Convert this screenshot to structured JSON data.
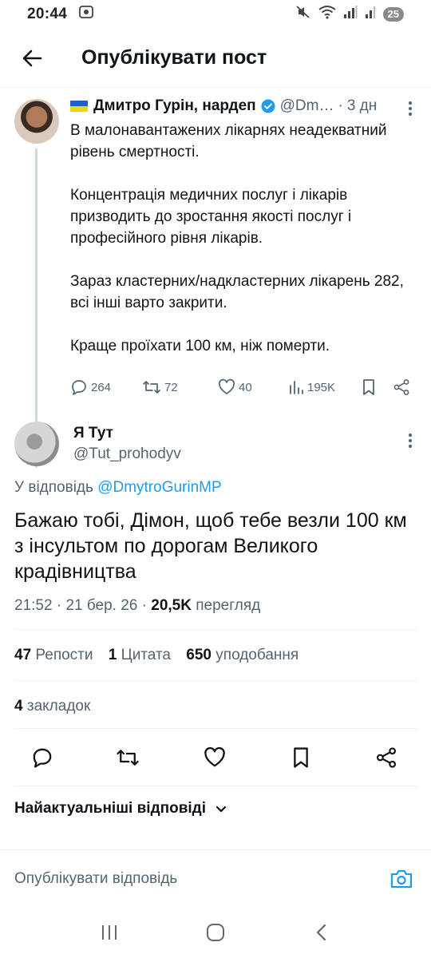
{
  "status_bar": {
    "time": "20:44",
    "battery": "25"
  },
  "header": {
    "title": "Опублікувати пост"
  },
  "parent_tweet": {
    "author": "Дмитро Гурін, нардеп",
    "handle": "@Dm…",
    "age": "3 дн",
    "paragraphs": [
      "В малонавантажених лікарнях неадекватний рівень смертності.",
      "Концентрація медичних послуг і лікарів призводить до зростання якості послуг і професійного рівня лікарів.",
      "Зараз кластерних/надкластерних лікарень 282, всі інші варто закрити.",
      "Краще проїхати 100 км, ніж померти."
    ],
    "replies": "264",
    "reposts": "72",
    "likes": "40",
    "views": "195K"
  },
  "reply_tweet": {
    "author": "Я Тут",
    "handle": "@Tut_prohodyv",
    "reply_to_prefix": "У відповідь",
    "reply_to_handle": "@DmytroGurinMP",
    "text": "Бажаю тобі, Дімон, щоб тебе везли 100 км з інсультом по дорогам Великого крадівництва",
    "time": "21:52",
    "date": "21 бер. 26",
    "views_count": "20,5K",
    "views_label": "перегляд",
    "reposts_count": "47",
    "reposts_label": "Репости",
    "quotes_count": "1",
    "quotes_label": "Цитата",
    "likes_count": "650",
    "likes_label": "уподобання",
    "bookmarks_count": "4",
    "bookmarks_label": "закладок"
  },
  "sort": {
    "label": "Найактуальніші відповіді"
  },
  "compose": {
    "placeholder": "Опублікувати відповідь"
  },
  "colors": {
    "accent": "#1d9bf0",
    "secondary_text": "#536471",
    "primary_text": "#0f1419",
    "divider": "#eff3f4"
  },
  "icons": [
    "back-arrow-icon",
    "verified-badge-icon",
    "more-vertical-icon",
    "reply-icon",
    "repost-icon",
    "like-icon",
    "views-icon",
    "bookmark-icon",
    "share-icon",
    "chevron-down-icon",
    "camera-icon",
    "recents-icon",
    "home-icon",
    "nav-back-icon"
  ]
}
